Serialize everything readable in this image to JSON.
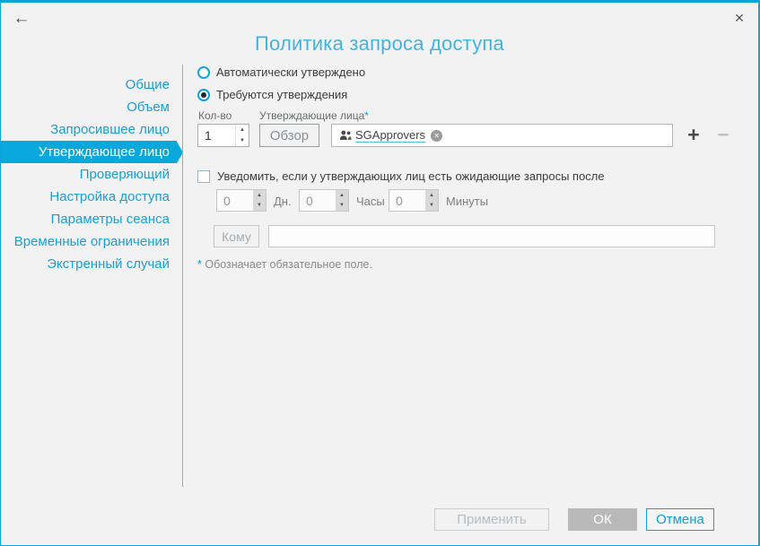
{
  "window": {
    "title": "Политика запроса доступа"
  },
  "icons": {
    "back": "←",
    "close": "✕",
    "plus": "+",
    "minus": "−",
    "up": "▲",
    "down": "▼",
    "tag_remove": "✕"
  },
  "sidebar": {
    "items": [
      {
        "label": "Общие",
        "selected": false
      },
      {
        "label": "Объем",
        "selected": false
      },
      {
        "label": "Запросившее лицо",
        "selected": false
      },
      {
        "label": "Утверждающее лицо",
        "selected": true
      },
      {
        "label": "Проверяющий",
        "selected": false
      },
      {
        "label": "Настройка доступа",
        "selected": false
      },
      {
        "label": "Параметры сеанса",
        "selected": false
      },
      {
        "label": "Временные ограничения",
        "selected": false
      },
      {
        "label": "Экстренный случай",
        "selected": false
      }
    ]
  },
  "main": {
    "radios": [
      {
        "label": "Автоматически утверждено",
        "checked": false
      },
      {
        "label": "Требуются утверждения",
        "checked": true
      }
    ],
    "qty": {
      "label": "Кол-во",
      "value": "1"
    },
    "approvers": {
      "label": "Утверждающие лица",
      "required_mark": "*",
      "browse_button": "Обзор",
      "tag": "SGApprovers"
    },
    "notify_label": "Уведомить, если у утверждающих лиц есть ожидающие запросы после",
    "delay": {
      "days": {
        "value": "0",
        "label": "Дн."
      },
      "hours": {
        "value": "0",
        "label": "Часы"
      },
      "minutes": {
        "value": "0",
        "label": "Минуты"
      }
    },
    "to": {
      "button": "Кому",
      "value": ""
    },
    "required_note": {
      "mark": "*",
      "text": " Обозначает обязательное поле."
    }
  },
  "footer": {
    "apply": "Применить",
    "ok": "ОК",
    "cancel": "Отмена"
  },
  "colors": {
    "accent": "#0ba3d9",
    "selected_item_bg": "#09a8dc",
    "title_text": "#41b4e1",
    "window_bg": "#f2f2f2",
    "ok_button_bg": "#b9b9b9",
    "disabled_text": "#b6bdc1"
  }
}
